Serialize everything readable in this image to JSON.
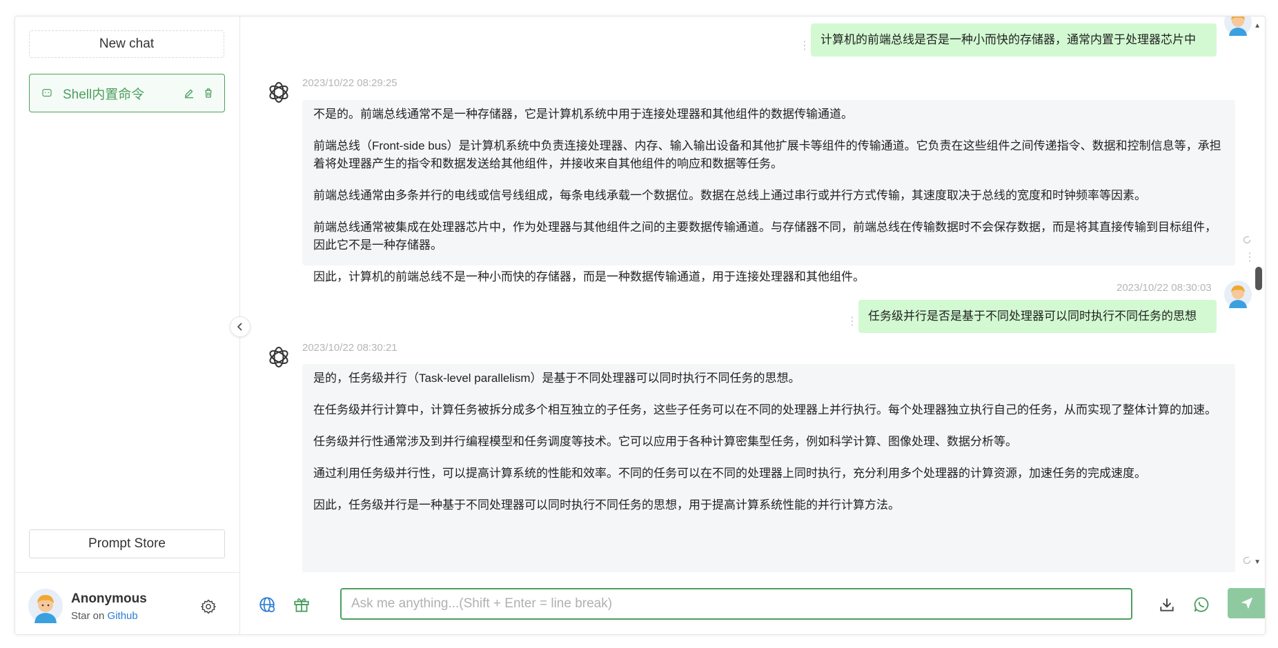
{
  "sidebar": {
    "new_chat_label": "New chat",
    "conversation": {
      "title": "Shell内置命令"
    },
    "prompt_store_label": "Prompt Store",
    "user": {
      "name": "Anonymous",
      "sub_prefix": "Star on",
      "sub_link": "Github"
    }
  },
  "messages": {
    "m1": {
      "role": "user",
      "text": "计算机的前端总线是否是一种小而快的存储器，通常内置于处理器芯片中"
    },
    "m2": {
      "role": "assistant",
      "time": "2023/10/22 08:29:25",
      "paragraphs": [
        "不是的。前端总线通常不是一种存储器，它是计算机系统中用于连接处理器和其他组件的数据传输通道。",
        "前端总线（Front-side bus）是计算机系统中负责连接处理器、内存、输入输出设备和其他扩展卡等组件的传输通道。它负责在这些组件之间传递指令、数据和控制信息等，承担着将处理器产生的指令和数据发送给其他组件，并接收来自其他组件的响应和数据等任务。",
        "前端总线通常由多条并行的电线或信号线组成，每条电线承载一个数据位。数据在总线上通过串行或并行方式传输，其速度取决于总线的宽度和时钟频率等因素。",
        "前端总线通常被集成在处理器芯片中，作为处理器与其他组件之间的主要数据传输通道。与存储器不同，前端总线在传输数据时不会保存数据，而是将其直接传输到目标组件，因此它不是一种存储器。",
        "因此，计算机的前端总线不是一种小而快的存储器，而是一种数据传输通道，用于连接处理器和其他组件。"
      ]
    },
    "m3": {
      "role": "user",
      "time": "2023/10/22 08:30:03",
      "text": "任务级并行是否是基于不同处理器可以同时执行不同任务的思想"
    },
    "m4": {
      "role": "assistant",
      "time": "2023/10/22 08:30:21",
      "paragraphs": [
        "是的，任务级并行（Task-level parallelism）是基于不同处理器可以同时执行不同任务的思想。",
        "在任务级并行计算中，计算任务被拆分成多个相互独立的子任务，这些子任务可以在不同的处理器上并行执行。每个处理器独立执行自己的任务，从而实现了整体计算的加速。",
        "任务级并行性通常涉及到并行编程模型和任务调度等技术。它可以应用于各种计算密集型任务，例如科学计算、图像处理、数据分析等。",
        "通过利用任务级并行性，可以提高计算系统的性能和效率。不同的任务可以在不同的处理器上同时执行，充分利用多个处理器的计算资源，加速任务的完成速度。",
        "因此，任务级并行是一种基于不同处理器可以同时执行不同任务的思想，用于提高计算系统性能的并行计算方法。"
      ]
    }
  },
  "input": {
    "placeholder": "Ask me anything...(Shift + Enter = line break)"
  },
  "icons": {
    "gpt": "openai-logo-icon",
    "web": "globe-icon",
    "gift": "gift-icon",
    "download": "download-icon",
    "whatsapp": "whatsapp-icon",
    "send": "send-icon",
    "settings": "gear-icon"
  },
  "colors": {
    "accent": "#4b9e5f",
    "user_bubble": "#d2f9d1",
    "ai_bubble": "#f4f6f8",
    "send_btn": "#8fc9a0",
    "link": "#2a7bd6"
  }
}
